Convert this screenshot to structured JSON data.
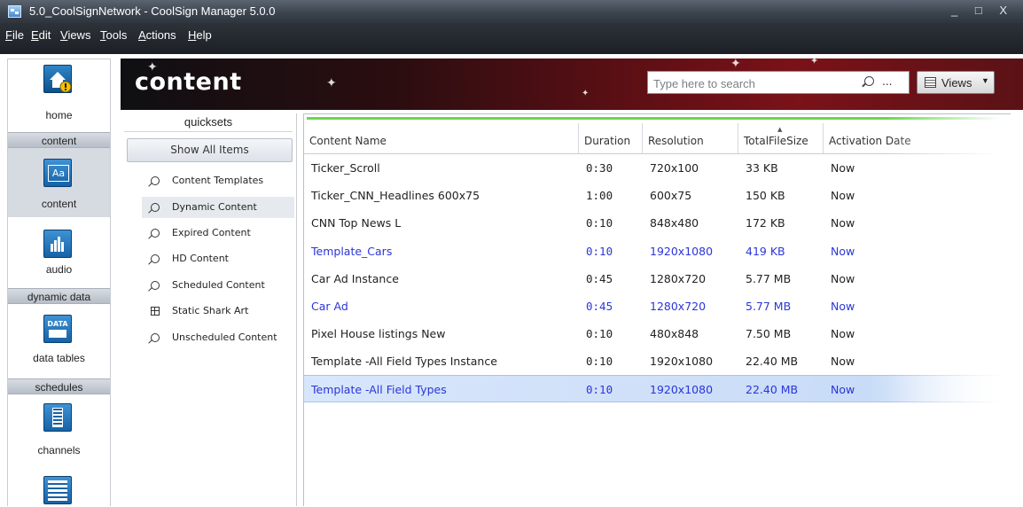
{
  "window": {
    "title": "5.0_CoolSignNetwork - CoolSign Manager 5.0.0",
    "controls": "_ □ X"
  },
  "menu": [
    "File",
    "Edit",
    "Views",
    "Tools",
    "Actions",
    "Help"
  ],
  "nav": {
    "home_label": "home",
    "sections": {
      "content": "content",
      "dynamic_data": "dynamic data",
      "schedules": "schedules"
    },
    "items": {
      "content": "content",
      "audio": "audio",
      "data_tables": "data tables",
      "channels": "channels"
    },
    "data_icon_text": "DATA",
    "content_icon_text": "Aa"
  },
  "header": {
    "title": "content",
    "search_placeholder": "Type here to search",
    "search_more": "...",
    "views_label": "Views",
    "views_caret": "▼"
  },
  "quicksets": {
    "title": "quicksets",
    "show_all": "Show All Items",
    "items": [
      {
        "label": "Content Templates",
        "icon": "search-icon"
      },
      {
        "label": "Dynamic Content",
        "icon": "search-icon",
        "selected": true
      },
      {
        "label": "Expired Content",
        "icon": "search-icon"
      },
      {
        "label": "HD Content",
        "icon": "search-icon"
      },
      {
        "label": "Scheduled Content",
        "icon": "search-icon"
      },
      {
        "label": "Static Shark Art",
        "icon": "grid-icon"
      },
      {
        "label": "Unscheduled Content",
        "icon": "search-icon"
      }
    ]
  },
  "table": {
    "columns": [
      "Content Name",
      "Duration",
      "Resolution",
      "TotalFileSize",
      "Activation Date"
    ],
    "sort_indicator": "▲",
    "rows": [
      {
        "name": "Ticker_Scroll",
        "duration": "0:30",
        "resolution": "720x100",
        "size": "33 KB",
        "activation": "Now"
      },
      {
        "name": "Ticker_CNN_Headlines 600x75",
        "duration": "1:00",
        "resolution": "600x75",
        "size": "150 KB",
        "activation": "Now"
      },
      {
        "name": "CNN Top News L",
        "duration": "0:10",
        "resolution": "848x480",
        "size": "172 KB",
        "activation": "Now"
      },
      {
        "name": "Template_Cars",
        "duration": "0:10",
        "resolution": "1920x1080",
        "size": "419 KB",
        "activation": "Now"
      },
      {
        "name": "Car Ad Instance",
        "duration": "0:45",
        "resolution": "1280x720",
        "size": "5.77 MB",
        "activation": "Now"
      },
      {
        "name": "Car Ad",
        "duration": "0:45",
        "resolution": "1280x720",
        "size": "5.77 MB",
        "activation": "Now"
      },
      {
        "name": "Pixel House listings New",
        "duration": "0:10",
        "resolution": "480x848",
        "size": "7.50 MB",
        "activation": "Now"
      },
      {
        "name": "Template -All Field Types Instance",
        "duration": "0:10",
        "resolution": "1920x1080",
        "size": "22.40 MB",
        "activation": "Now"
      },
      {
        "name": "Template -All Field Types",
        "duration": "0:10",
        "resolution": "1920x1080",
        "size": "22.40 MB",
        "activation": "Now"
      }
    ],
    "template_color": "#2b35d8"
  }
}
